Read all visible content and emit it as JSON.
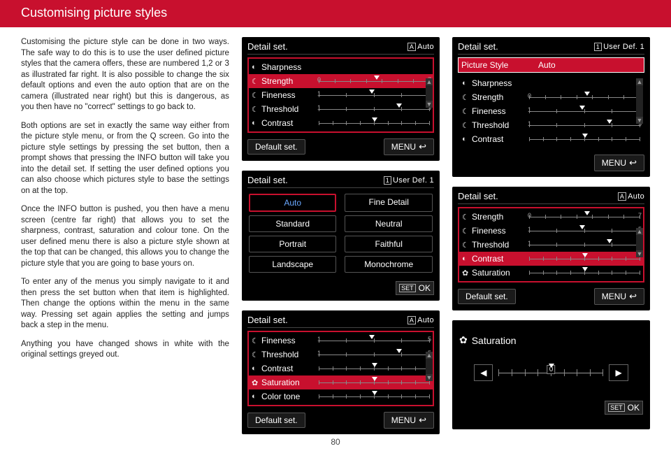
{
  "header": {
    "title": "Customising picture styles"
  },
  "article": {
    "p1": "Customising the picture style can be done in two ways. The safe way to do this is to use the user defined picture styles that the camera offers, these are numbered 1,2 or 3 as illustrated far right. It is also possible to change the six default options and even the auto option that are on the camera (illustrated near right) but this is dangerous, as you then have no \"correct\" settings to go back to.",
    "p2": "Both options are set in exactly the same way either from the picture style menu, or from the Q screen. Go into the picture style settings by pressing the set button, then a prompt shows that pressing the INFO button will take you into the detail set. If setting the user defined options you can also choose which pictures style to base the settings on at the top.",
    "p3": "Once the INFO button is pushed, you then have a menu screen (centre far right)  that allows you to set the sharpness, contrast, saturation and colour tone. On the user defined menu there is also a picture style shown at the top that can be changed, this allows you to change the picture style that you are going to base yours on.",
    "p4": "To enter any of the menus you simply navigate to it and then press the set button when that item is highlighted. Then change the options within the menu in the same way. Pressing set again applies the setting and jumps back a step in the menu.",
    "p5": "Anything you have changed shows in white with the original settings greyed out."
  },
  "labels": {
    "detail_set": "Detail set.",
    "default_set": "Default set.",
    "menu": "MENU",
    "set": "SET",
    "ok": "OK",
    "auto": "Auto",
    "userdef1": "User Def. 1",
    "picture_style": "Picture Style",
    "sharpness": "Sharpness",
    "strength": "Strength",
    "fineness": "Fineness",
    "threshold": "Threshold",
    "contrast": "Contrast",
    "saturation": "Saturation",
    "color_tone": "Color tone",
    "mode_a": "A",
    "mode_1": "1"
  },
  "styles": {
    "auto": "Auto",
    "standard": "Standard",
    "portrait": "Portrait",
    "landscape": "Landscape",
    "fine_detail": "Fine Detail",
    "neutral": "Neutral",
    "faithful": "Faithful",
    "monochrome": "Monochrome"
  },
  "scales": {
    "sharp_min": "0",
    "sharp_max": "7",
    "fine_min": "1",
    "fine_max": "5",
    "sym_zero": "0"
  },
  "page_number": "80"
}
